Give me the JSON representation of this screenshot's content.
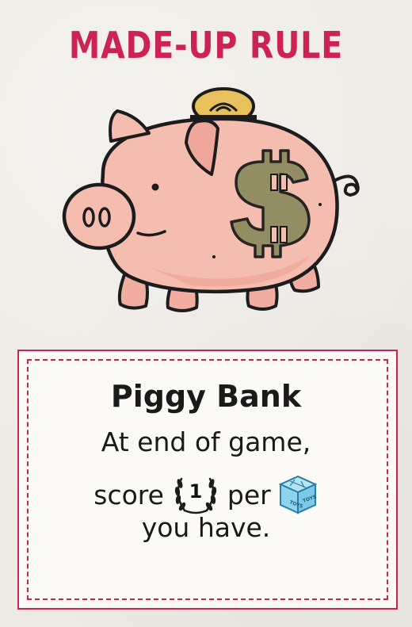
{
  "card": {
    "category": "MADE-UP RULE",
    "rule_title": "Piggy Bank",
    "rule_text_line1": "At end of game,",
    "rule_text_score": "score",
    "score_value": "1",
    "rule_text_per": "per",
    "rule_text_line3": "you have.",
    "die_label": "TOYS",
    "colors": {
      "accent": "#cc2354",
      "pig_body": "#f3b3a6",
      "coin": "#e9c15c",
      "dollar": "#8d8b5e",
      "die": "#8fd3ee"
    }
  }
}
